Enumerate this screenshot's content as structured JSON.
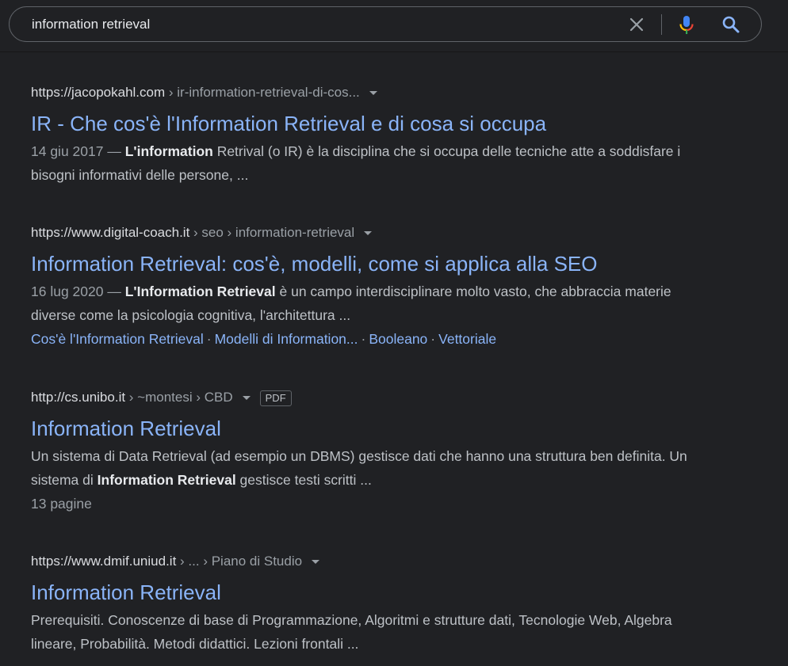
{
  "search": {
    "query": "information retrieval"
  },
  "results": [
    {
      "host": "https://jacopokahl.com",
      "path": " › ir-information-retrieval-di-cos...",
      "title": "IR - Che cos'è l'Information Retrieval e di cosa si occupa",
      "date": "14 giu 2017",
      "date_sep": " — ",
      "snippet_parts": [
        "L'",
        "information",
        " Retrival (o IR) è la disciplina che si occupa delle tecniche atte a soddisfare i bisogni informativi delle persone, ..."
      ]
    },
    {
      "host": "https://www.digital-coach.it",
      "path": " › seo › information-retrieval",
      "title": "Information Retrieval: cos'è, modelli, come si applica alla SEO",
      "date": "16 lug 2020",
      "date_sep": " — ",
      "snippet_parts": [
        "L'",
        "Information Retrieval",
        " è un campo interdisciplinare molto vasto, che abbraccia materie diverse come la psicologia cognitiva, l'architettura ..."
      ],
      "sitelinks": [
        "Cos'è l'Information Retrieval",
        "Modelli di Information...",
        "Booleano",
        "Vettoriale"
      ],
      "sitelink_sep": "·"
    },
    {
      "host": "http://cs.unibo.it",
      "path": " › ~montesi › CBD",
      "badge": "PDF",
      "title": "Information Retrieval",
      "snippet_parts": [
        "Un sistema di Data Retrieval (ad esempio un DBMS) gestisce dati che hanno una struttura ben definita. Un sistema di ",
        "Information Retrieval",
        " gestisce testi scritti ..."
      ],
      "pages": "13 pagine"
    },
    {
      "host": "https://www.dmif.uniud.it",
      "path": " › ... › Piano di Studio",
      "title": "Information Retrieval",
      "snippet_parts": [
        "Prerequisiti. Conoscenze di base di Programmazione, Algoritmi e strutture dati, Tecnologie Web, Algebra lineare, Probabilità. Metodi didattici. Lezioni frontali ..."
      ]
    }
  ],
  "icons": {
    "clear": "close-icon",
    "mic": "microphone-icon",
    "search": "search-icon"
  },
  "colors": {
    "background": "#202124",
    "link": "#8ab4f8",
    "text": "#bdc1c6",
    "mic_blue": "#4285f4",
    "mic_red": "#ea4335",
    "mic_yellow": "#fbbc04",
    "mic_green": "#34a853"
  }
}
